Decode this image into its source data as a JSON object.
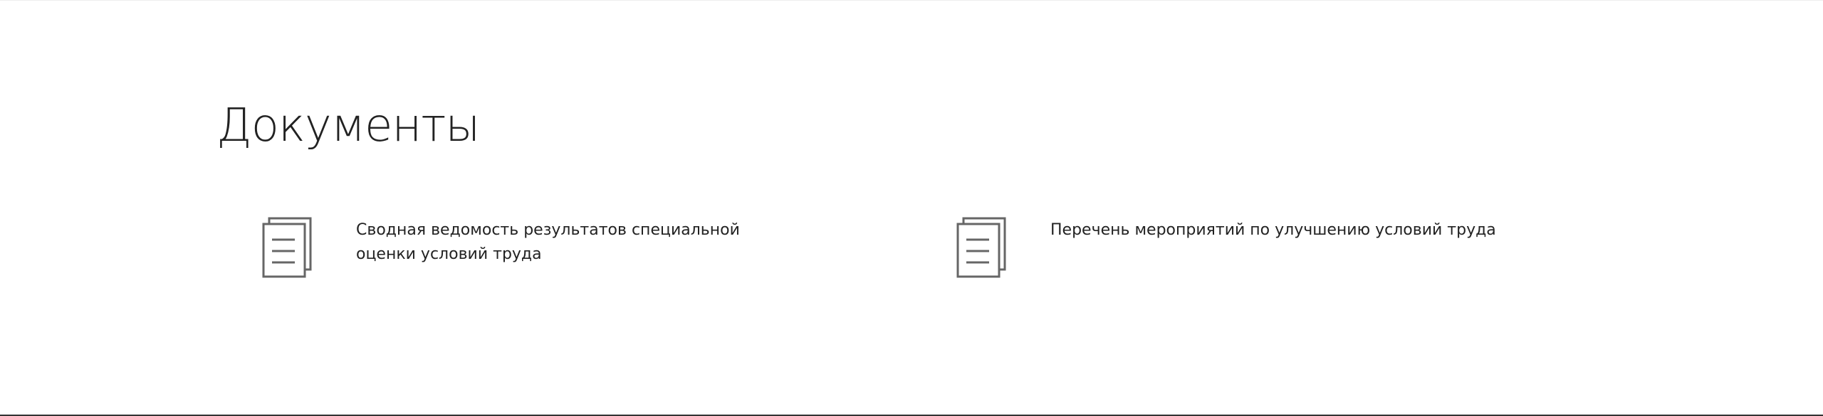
{
  "section": {
    "title": "Документы"
  },
  "documents": [
    {
      "label": "Сводная ведомость результатов специальной оценки условий труда",
      "icon": "document-icon"
    },
    {
      "label": "Перечень мероприятий по улучшению условий труда",
      "icon": "document-icon"
    }
  ],
  "colors": {
    "text": "#222222",
    "icon_stroke": "#666666",
    "background": "#ffffff"
  }
}
